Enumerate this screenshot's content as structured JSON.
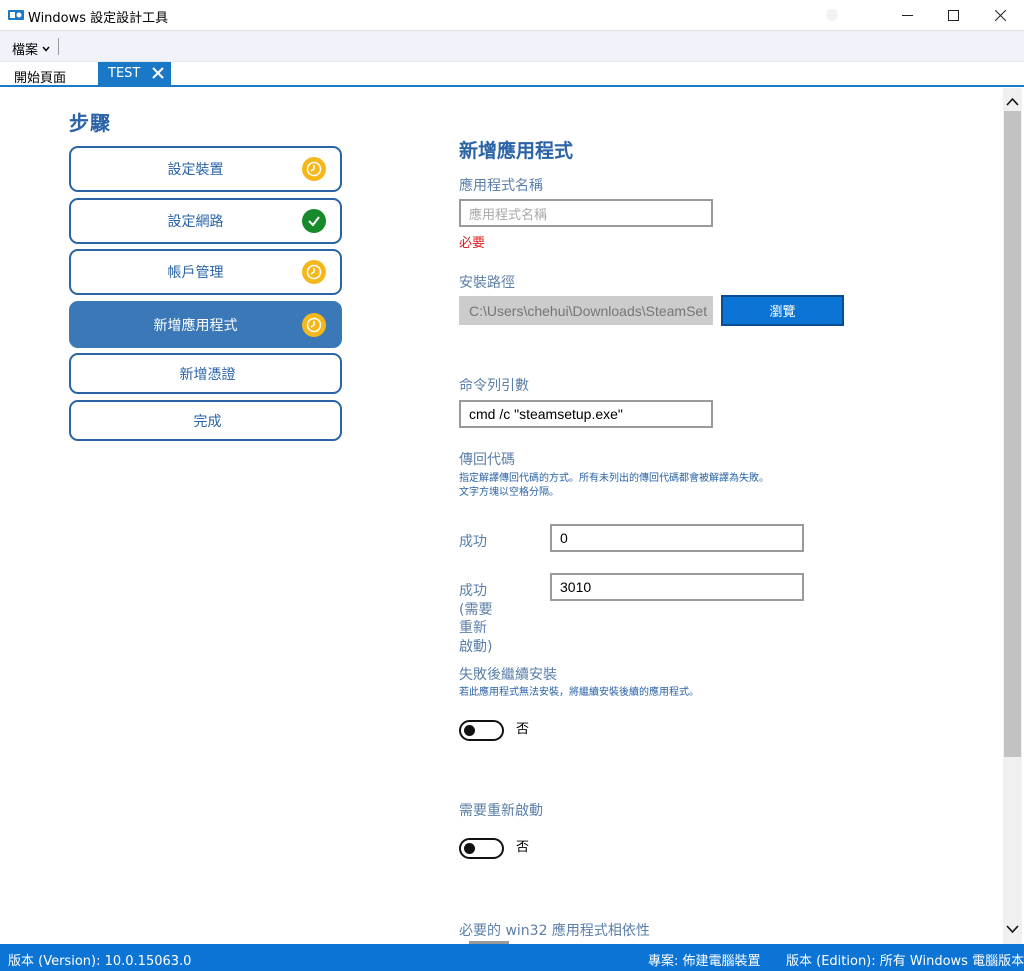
{
  "window": {
    "title": "Windows 設定設計工具",
    "icon": "windows-config-designer-icon"
  },
  "menu": {
    "file_label": "檔案"
  },
  "tabs": {
    "home_label": "開始頁面",
    "active_label": "TEST"
  },
  "steps": {
    "title": "步驟",
    "items": [
      {
        "label": "設定裝置",
        "status": "pending"
      },
      {
        "label": "設定網路",
        "status": "done"
      },
      {
        "label": "帳戶管理",
        "status": "pending"
      },
      {
        "label": "新增應用程式",
        "status": "pending",
        "active": true
      },
      {
        "label": "新增憑證"
      },
      {
        "label": "完成"
      }
    ]
  },
  "form": {
    "title": "新增應用程式",
    "app_name": {
      "label": "應用程式名稱",
      "placeholder": "應用程式名稱",
      "required_text": "必要"
    },
    "install_path": {
      "label": "安裝路徑",
      "value": "C:\\Users\\chehui\\Downloads\\SteamSet",
      "browse_label": "瀏覽"
    },
    "command_line": {
      "label": "命令列引數",
      "value": "cmd /c \"steamsetup.exe\""
    },
    "return_codes": {
      "label": "傳回代碼",
      "hint_line1": "指定解譯傳回代碼的方式。所有未列出的傳回代碼都會被解譯為失敗。",
      "hint_line2": "文字方塊以空格分隔。",
      "success_label": "成功",
      "success_value": "0",
      "reboot_label_1": "成功",
      "reboot_label_2": "(需要",
      "reboot_label_3": "重新",
      "reboot_label_4": "啟動)",
      "reboot_value": "3010"
    },
    "continue_on_fail": {
      "label": "失敗後繼續安裝",
      "hint": "若此應用程式無法安裝，將繼續安裝後續的應用程式。",
      "toggle_text": "否"
    },
    "restart_required": {
      "label": "需要重新啟動",
      "toggle_text": "否"
    },
    "dependencies": {
      "label": "必要的 win32 應用程式相依性"
    }
  },
  "statusbar": {
    "version": "版本 (Version): 10.0.15063.0",
    "project": "專案: 佈建電腦裝置",
    "edition": "版本 (Edition): 所有 Windows 電腦版本"
  },
  "colors": {
    "accent": "#1a79c7",
    "heading": "#2a63a6",
    "pending": "#f5b81c",
    "done": "#178a2b",
    "required": "#e02020",
    "statusbar": "#0c74d4"
  }
}
